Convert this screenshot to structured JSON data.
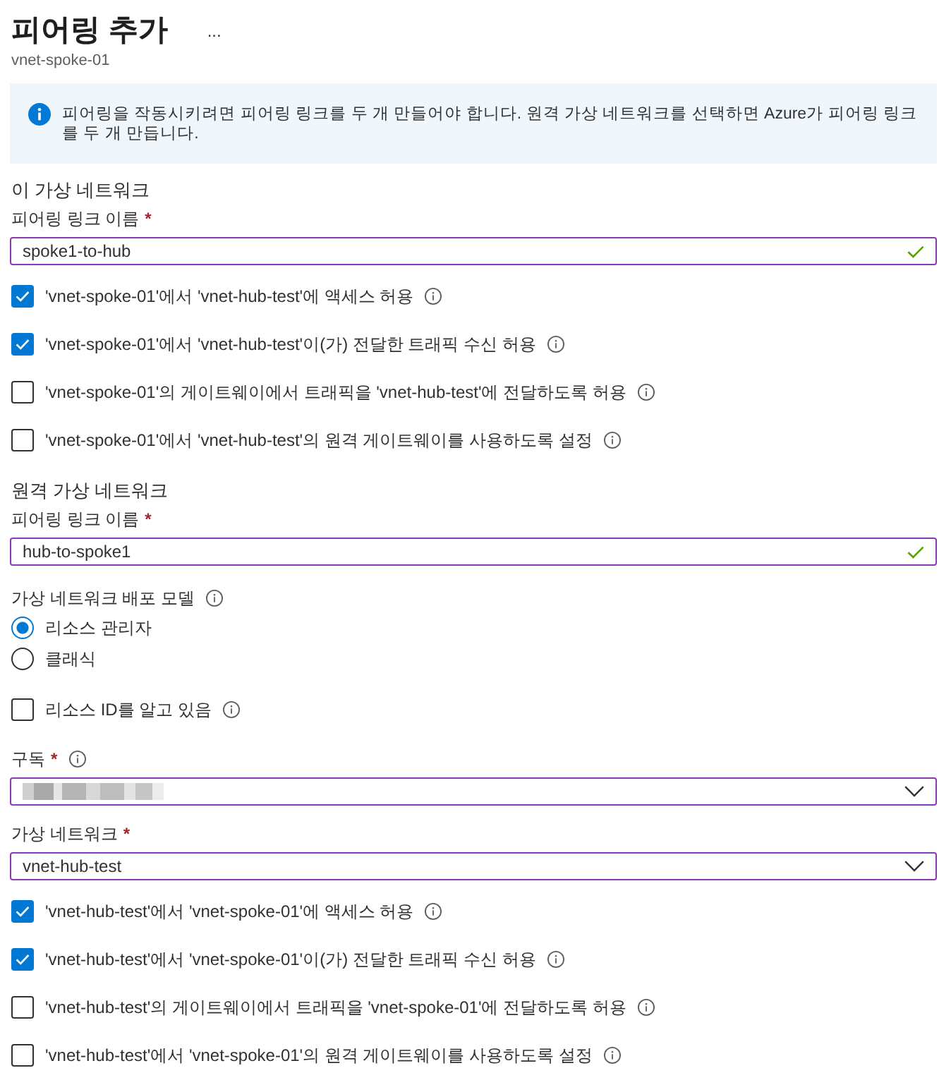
{
  "header": {
    "title": "피어링 추가",
    "menu": "...",
    "subtitle": "vnet-spoke-01"
  },
  "info_banner": {
    "text": "피어링을 작동시키려면 피어링 링크를 두 개 만들어야 합니다. 원격 가상 네트워크를 선택하면 Azure가 피어링 링크를 두 개 만듭니다."
  },
  "sections": [
    {
      "heading": "이 가상 네트워크",
      "items": [
        {
          "kind": "text_input",
          "label": "피어링 링크 이름",
          "required_mark": "*",
          "value": "spoke1-to-hub",
          "valid": true
        },
        {
          "kind": "checkbox",
          "label": "'vnet-spoke-01'에서 'vnet-hub-test'에 액세스 허용",
          "checked": true,
          "info": true
        },
        {
          "kind": "checkbox",
          "label": "'vnet-spoke-01'에서 'vnet-hub-test'이(가) 전달한 트래픽 수신 허용",
          "checked": true,
          "info": true
        },
        {
          "kind": "checkbox",
          "label": "'vnet-spoke-01'의 게이트웨이에서 트래픽을 'vnet-hub-test'에 전달하도록 허용",
          "checked": false,
          "info": true
        },
        {
          "kind": "checkbox",
          "label": "'vnet-spoke-01'에서 'vnet-hub-test'의 원격 게이트웨이를 사용하도록 설정",
          "checked": false,
          "info": true
        }
      ]
    },
    {
      "heading": "원격 가상 네트워크",
      "items": [
        {
          "kind": "text_input",
          "label": "피어링 링크 이름",
          "required_mark": "*",
          "value": "hub-to-spoke1",
          "valid": true
        },
        {
          "kind": "radio_group",
          "label": "가상 네트워크 배포 모델",
          "info": true,
          "options": [
            {
              "label": "리소스 관리자",
              "selected": true
            },
            {
              "label": "클래식",
              "selected": false
            }
          ]
        },
        {
          "kind": "checkbox",
          "label": "리소스 ID를 알고 있음",
          "checked": false,
          "info": true
        },
        {
          "kind": "select",
          "label": "구독",
          "required_mark": "*",
          "info": true,
          "value_hidden": true
        },
        {
          "kind": "select",
          "label": "가상 네트워크",
          "required_mark": "*",
          "value": "vnet-hub-test"
        },
        {
          "kind": "checkbox",
          "label": "'vnet-hub-test'에서 'vnet-spoke-01'에 액세스 허용",
          "checked": true,
          "info": true
        },
        {
          "kind": "checkbox",
          "label": "'vnet-hub-test'에서 'vnet-spoke-01'이(가) 전달한 트래픽 수신 허용",
          "checked": true,
          "info": true
        },
        {
          "kind": "checkbox",
          "label": "'vnet-hub-test'의 게이트웨이에서 트래픽을 'vnet-spoke-01'에 전달하도록 허용",
          "checked": false,
          "info": true
        },
        {
          "kind": "checkbox",
          "label": "'vnet-hub-test'에서 'vnet-spoke-01'의 원격 게이트웨이를 사용하도록 설정",
          "checked": false,
          "info": true
        }
      ]
    }
  ]
}
